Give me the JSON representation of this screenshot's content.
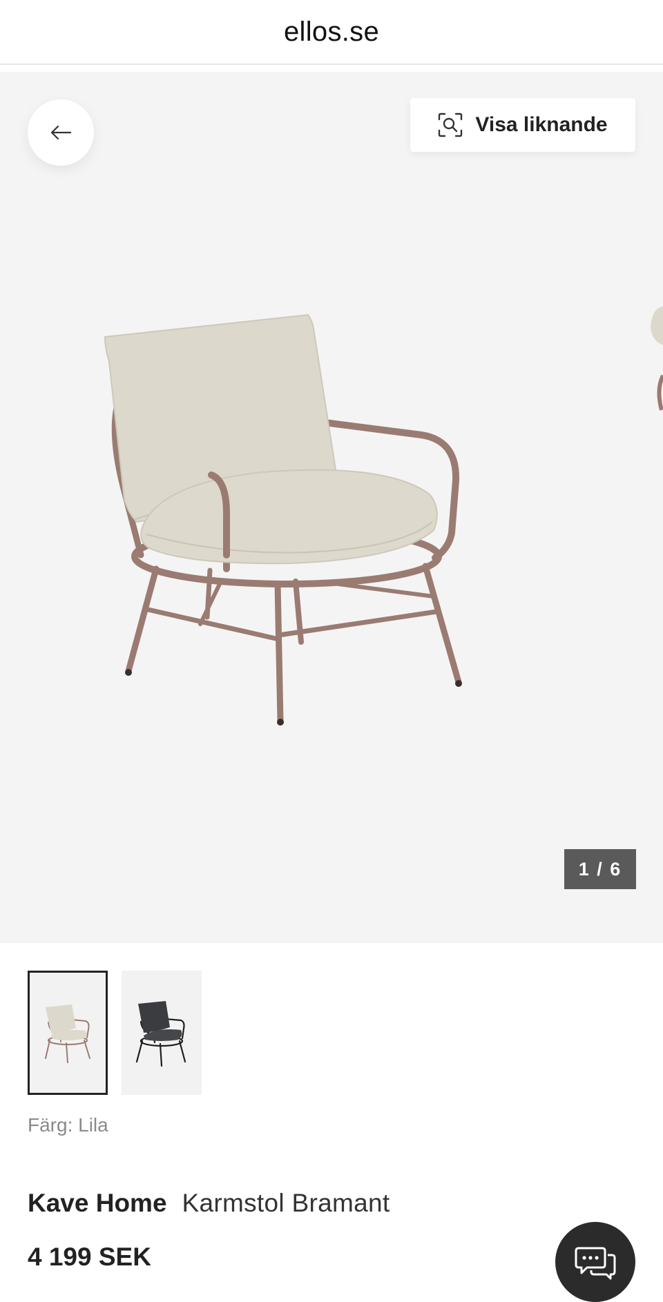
{
  "header": {
    "site_title": "ellos.se"
  },
  "gallery": {
    "back_icon": "arrow-left-icon",
    "similar_button": {
      "label": "Visa liknande",
      "icon": "visual-search-icon"
    },
    "counter": "1 / 6",
    "current_image": 1,
    "total_images": 6
  },
  "variants": [
    {
      "name": "beige-taupe-chair",
      "selected": true
    },
    {
      "name": "dark-grey-chair",
      "selected": false
    }
  ],
  "product": {
    "color_line": "Färg: Lila",
    "brand": "Kave Home",
    "name": "Karmstol Bramant",
    "price": "4 199 SEK"
  },
  "chat": {
    "icon": "chat-bubbles-icon"
  },
  "colors": {
    "gallery_background": "#f5f4f4",
    "frame_color": "#9a7b72",
    "cushion_color": "#dcd8cb",
    "counter_background": "#5a5a5a",
    "chat_background": "#2b2b2b"
  }
}
